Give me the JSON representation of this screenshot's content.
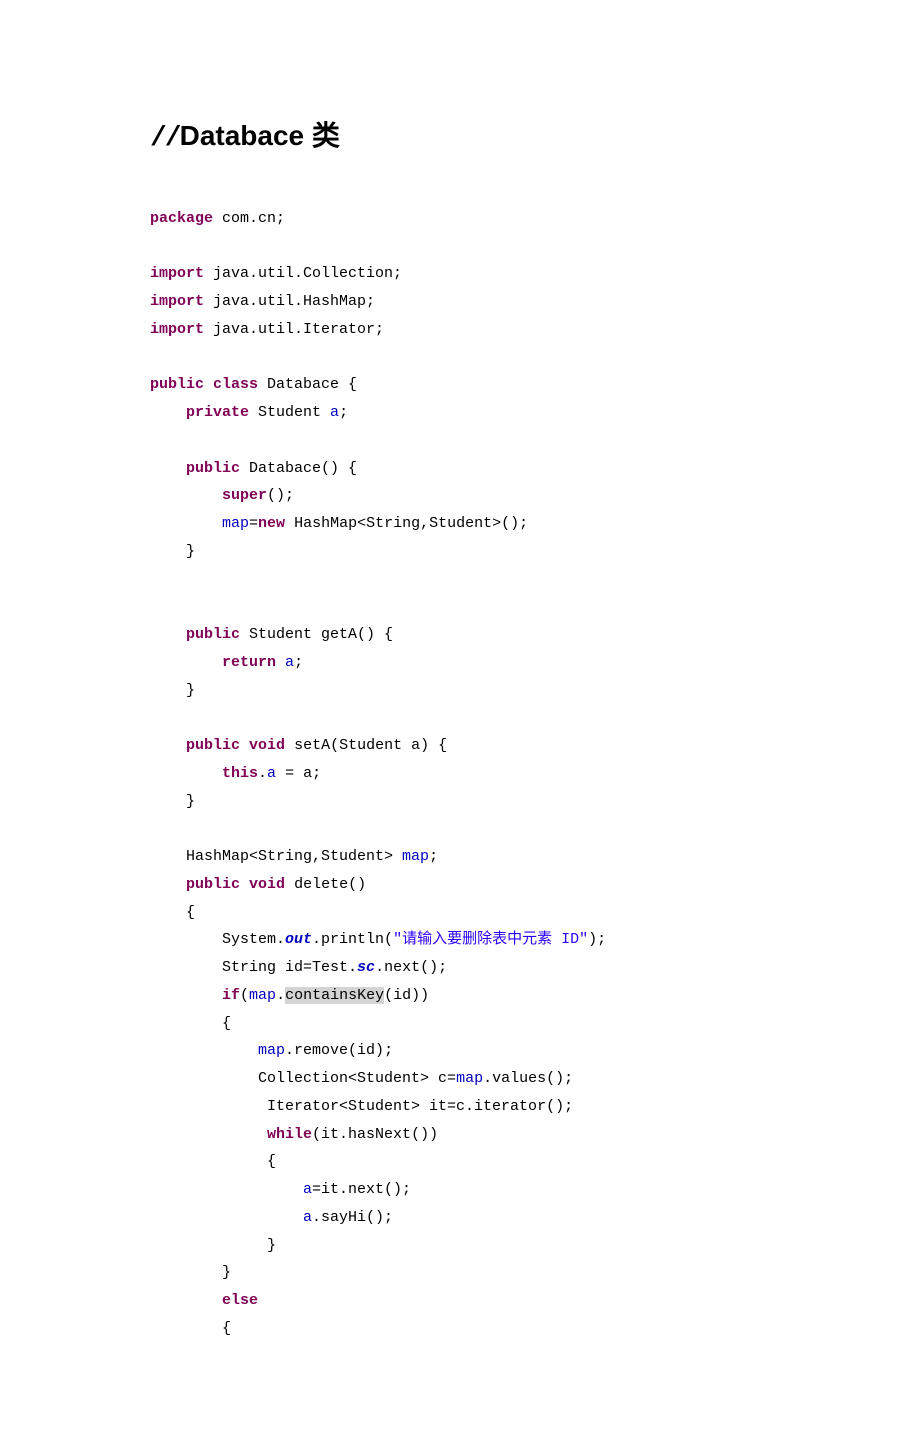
{
  "heading": "//Databace 类",
  "code": {
    "package_kw": "package",
    "package_name": " com.cn;",
    "import_kw": "import",
    "import1": " java.util.Collection;",
    "import2": " java.util.HashMap;",
    "import3": " java.util.Iterator;",
    "public_kw": "public",
    "class_kw": "class",
    "databace": " Databace {",
    "private_kw": "private",
    "student_a": " Student ",
    "a_fld": "a",
    "semicolon": ";",
    "databace_ctor": " Databace() {",
    "super_kw": "super",
    "paren_semi": "();",
    "map_fld": "map",
    "eq": "=",
    "new_kw": "new",
    "hashmap_ctor": " HashMap<String,Student>();",
    "close_brace": "    }",
    "getA_sig": " Student getA() {",
    "return_kw": "return",
    "sp_a": " ",
    "void_kw": "void",
    "setA_sig": " setA(Student a) {",
    "this_kw": "this",
    "dot_a_eq_a": ".",
    "assign_a": " = a;",
    "hashmap_decl": "    HashMap<String,Student> ",
    "delete_sig": " delete()",
    "open_brace": "    {",
    "system": "        System.",
    "out_fld": "out",
    "println": ".println(",
    "str1": "\"请输入要删除表中元素 ID\"",
    "close_p": ");",
    "string_id": "        String id=Test.",
    "sc_fld": "sc",
    "next": ".next();",
    "if_kw": "if",
    "if_open": "(",
    "dot": ".",
    "containsKey": "containsKey",
    "id_close": "(id))",
    "open_brace2": "        {",
    "map_remove": ".remove(id);",
    "collection": "            Collection<Student> c=",
    "values": ".values();",
    "iterator": "             Iterator<Student> it=c.iterator();",
    "while_kw": "while",
    "hasNext": "(it.hasNext())",
    "open_brace3": "             {",
    "a_it_next": "=it.next();",
    "a_sayHi": ".sayHi();",
    "close_brace3": "             }",
    "close_brace2": "        }",
    "else_kw": "else",
    "open_brace4": "        {"
  }
}
